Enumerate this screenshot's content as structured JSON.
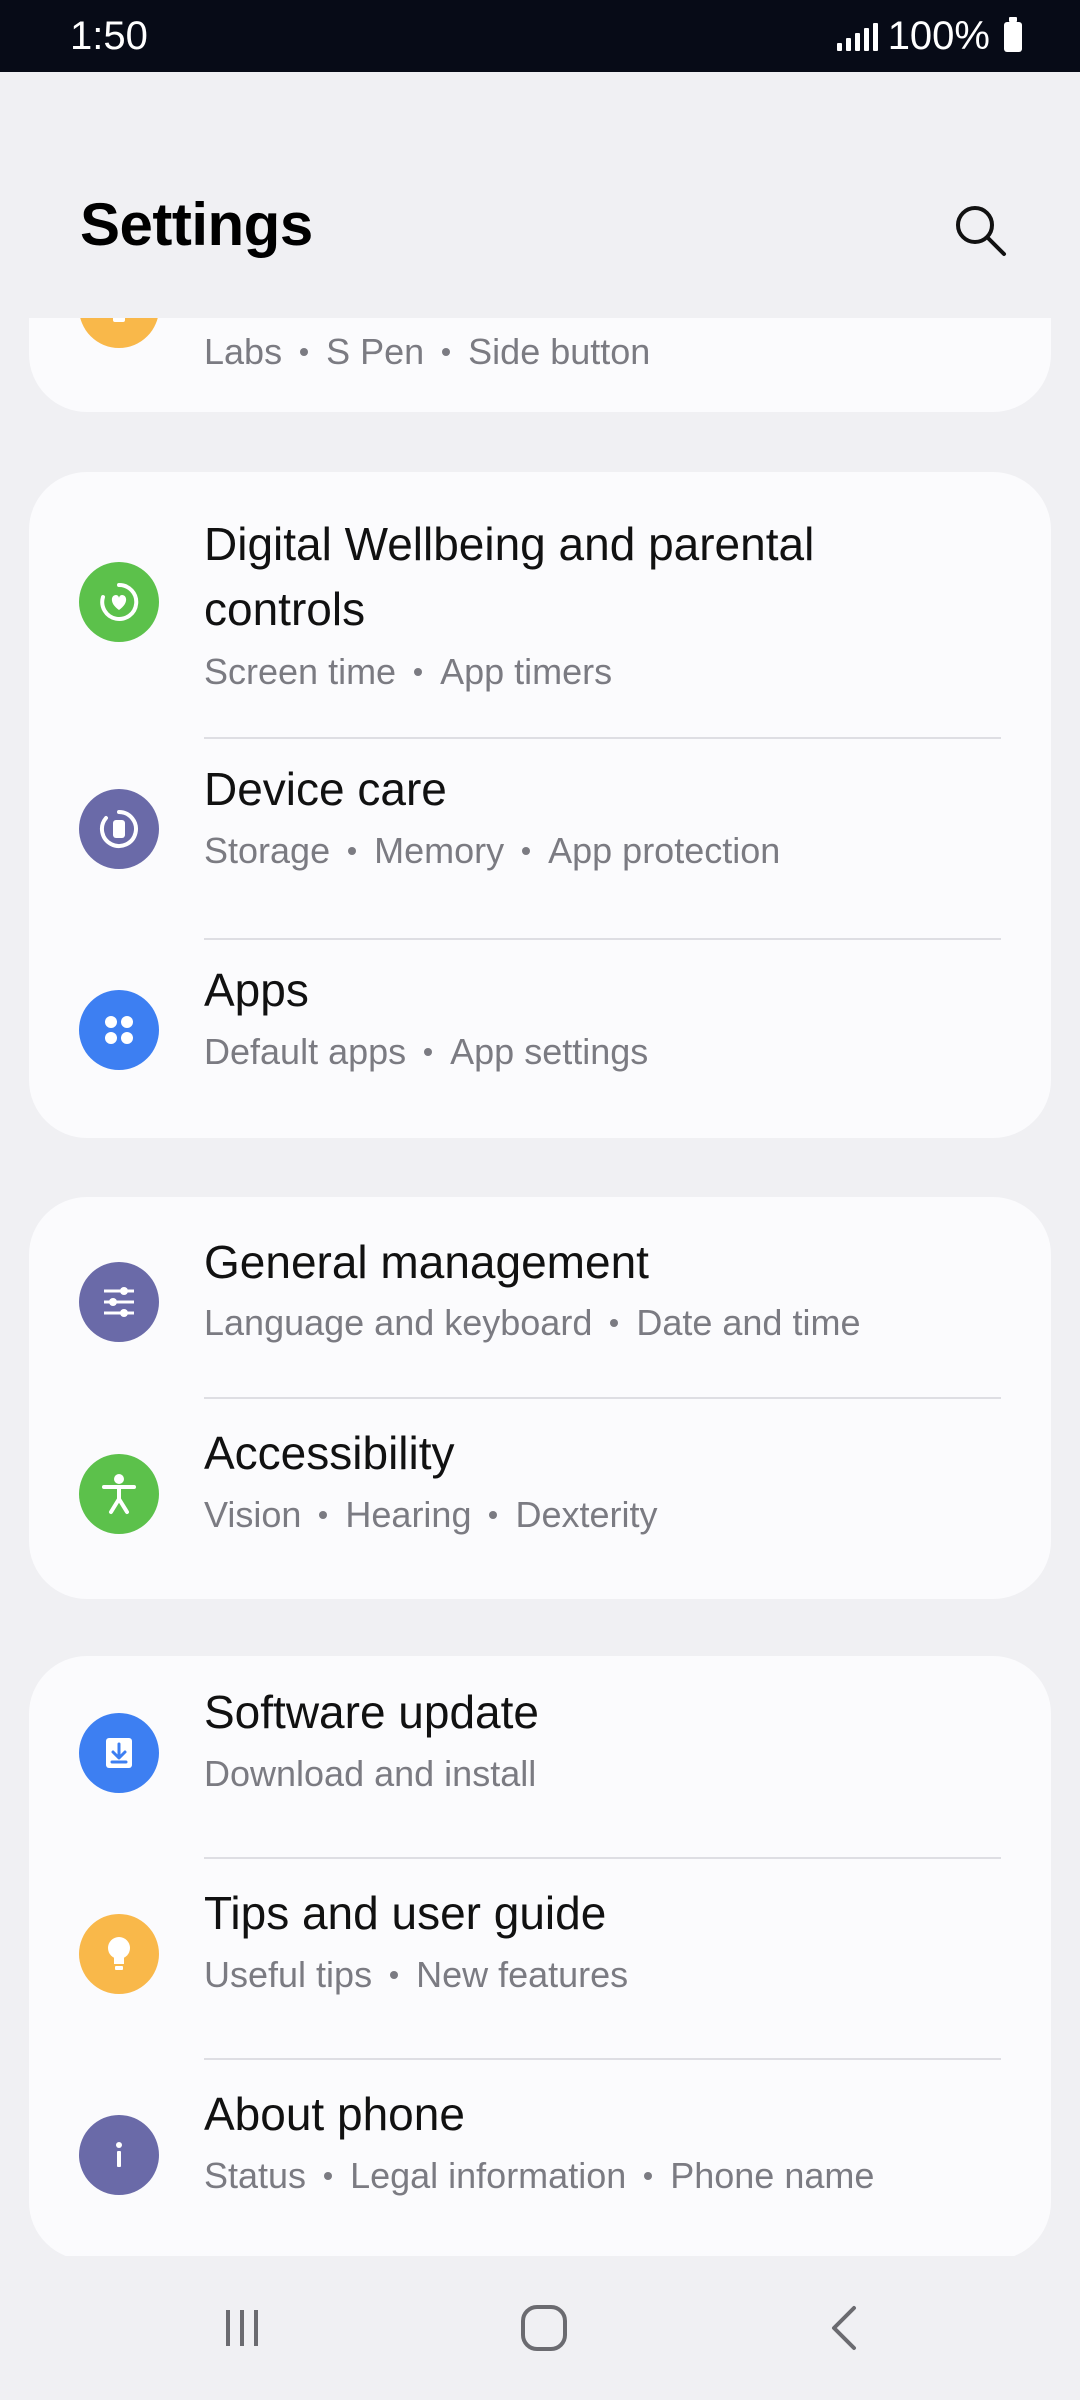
{
  "status_bar": {
    "time": "1:50",
    "battery": "100%"
  },
  "header": {
    "title": "Settings"
  },
  "partial_item": {
    "subtitle_parts": [
      "Labs",
      "S Pen",
      "Side button"
    ],
    "icon": "advanced-features-icon",
    "color": "#f9b84a"
  },
  "group1": [
    {
      "title_line1": "Digital Wellbeing and parental",
      "title_line2": "controls",
      "subtitle_parts": [
        "Screen time",
        "App timers"
      ],
      "icon": "wellbeing-icon",
      "color": "#5cc14b"
    },
    {
      "title": "Device care",
      "subtitle_parts": [
        "Storage",
        "Memory",
        "App protection"
      ],
      "icon": "device-care-icon",
      "color": "#6a6aa8"
    },
    {
      "title": "Apps",
      "subtitle_parts": [
        "Default apps",
        "App settings"
      ],
      "icon": "apps-icon",
      "color": "#3d7ff2"
    }
  ],
  "group2": [
    {
      "title": "General management",
      "subtitle_parts": [
        "Language and keyboard",
        "Date and time"
      ],
      "icon": "sliders-icon",
      "color": "#6a6aa8"
    },
    {
      "title": "Accessibility",
      "subtitle_parts": [
        "Vision",
        "Hearing",
        "Dexterity"
      ],
      "icon": "accessibility-icon",
      "color": "#5cc14b"
    }
  ],
  "group3": [
    {
      "title": "Software update",
      "subtitle_parts": [
        "Download and install"
      ],
      "icon": "software-update-icon",
      "color": "#3d7ff2"
    },
    {
      "title": "Tips and user guide",
      "subtitle_parts": [
        "Useful tips",
        "New features"
      ],
      "icon": "lightbulb-icon",
      "color": "#f9b84a"
    },
    {
      "title": "About phone",
      "subtitle_parts": [
        "Status",
        "Legal information",
        "Phone name"
      ],
      "icon": "info-icon",
      "color": "#6a6aa8"
    }
  ],
  "nav": {
    "recents": "recents-icon",
    "home": "home-icon",
    "back": "back-icon"
  }
}
